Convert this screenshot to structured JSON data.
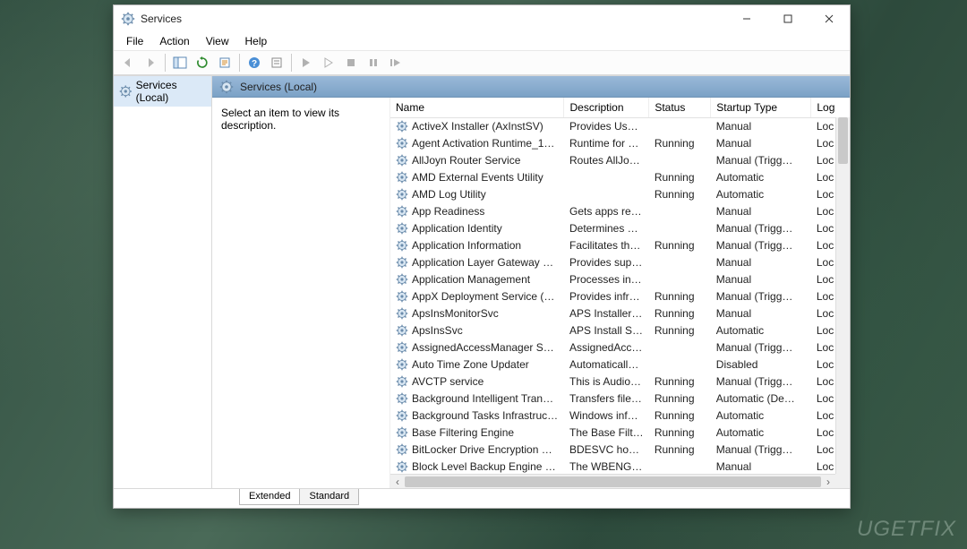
{
  "window": {
    "title": "Services"
  },
  "menu": {
    "file": "File",
    "action": "Action",
    "view": "View",
    "help": "Help"
  },
  "tree": {
    "root": "Services (Local)"
  },
  "header": {
    "title": "Services (Local)"
  },
  "desc_pane": {
    "prompt": "Select an item to view its description."
  },
  "columns": {
    "name": "Name",
    "description": "Description",
    "status": "Status",
    "startup": "Startup Type",
    "logon": "Log"
  },
  "tabs": {
    "extended": "Extended",
    "standard": "Standard"
  },
  "watermark": "UGETFIX",
  "services": [
    {
      "name": "ActiveX Installer (AxInstSV)",
      "desc": "Provides Use…",
      "status": "",
      "startup": "Manual",
      "logon": "Loc"
    },
    {
      "name": "Agent Activation Runtime_1…",
      "desc": "Runtime for …",
      "status": "Running",
      "startup": "Manual",
      "logon": "Loc"
    },
    {
      "name": "AllJoyn Router Service",
      "desc": "Routes AllJo…",
      "status": "",
      "startup": "Manual (Trigg…",
      "logon": "Loc"
    },
    {
      "name": "AMD External Events Utility",
      "desc": "",
      "status": "Running",
      "startup": "Automatic",
      "logon": "Loc"
    },
    {
      "name": "AMD Log Utility",
      "desc": "",
      "status": "Running",
      "startup": "Automatic",
      "logon": "Loc"
    },
    {
      "name": "App Readiness",
      "desc": "Gets apps re…",
      "status": "",
      "startup": "Manual",
      "logon": "Loc"
    },
    {
      "name": "Application Identity",
      "desc": "Determines …",
      "status": "",
      "startup": "Manual (Trigg…",
      "logon": "Loc"
    },
    {
      "name": "Application Information",
      "desc": "Facilitates th…",
      "status": "Running",
      "startup": "Manual (Trigg…",
      "logon": "Loc"
    },
    {
      "name": "Application Layer Gateway S…",
      "desc": "Provides sup…",
      "status": "",
      "startup": "Manual",
      "logon": "Loc"
    },
    {
      "name": "Application Management",
      "desc": "Processes in…",
      "status": "",
      "startup": "Manual",
      "logon": "Loc"
    },
    {
      "name": "AppX Deployment Service (A…",
      "desc": "Provides infr…",
      "status": "Running",
      "startup": "Manual (Trigg…",
      "logon": "Loc"
    },
    {
      "name": "ApsInsMonitorSvc",
      "desc": "APS Installer …",
      "status": "Running",
      "startup": "Manual",
      "logon": "Loc"
    },
    {
      "name": "ApsInsSvc",
      "desc": "APS Install S…",
      "status": "Running",
      "startup": "Automatic",
      "logon": "Loc"
    },
    {
      "name": "AssignedAccessManager Ser…",
      "desc": "AssignedAcc…",
      "status": "",
      "startup": "Manual (Trigg…",
      "logon": "Loc"
    },
    {
      "name": "Auto Time Zone Updater",
      "desc": "Automaticall…",
      "status": "",
      "startup": "Disabled",
      "logon": "Loc"
    },
    {
      "name": "AVCTP service",
      "desc": "This is Audio…",
      "status": "Running",
      "startup": "Manual (Trigg…",
      "logon": "Loc"
    },
    {
      "name": "Background Intelligent Tran…",
      "desc": "Transfers file…",
      "status": "Running",
      "startup": "Automatic (De…",
      "logon": "Loc"
    },
    {
      "name": "Background Tasks Infrastruc…",
      "desc": "Windows inf…",
      "status": "Running",
      "startup": "Automatic",
      "logon": "Loc"
    },
    {
      "name": "Base Filtering Engine",
      "desc": "The Base Filt…",
      "status": "Running",
      "startup": "Automatic",
      "logon": "Loc"
    },
    {
      "name": "BitLocker Drive Encryption S…",
      "desc": "BDESVC hos…",
      "status": "Running",
      "startup": "Manual (Trigg…",
      "logon": "Loc"
    },
    {
      "name": "Block Level Backup Engine S…",
      "desc": "The WBENGI…",
      "status": "",
      "startup": "Manual",
      "logon": "Loc"
    }
  ]
}
